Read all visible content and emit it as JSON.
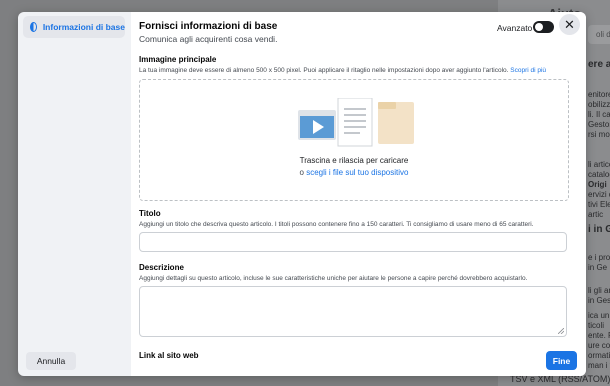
{
  "background": {
    "help_title": "Aiuto",
    "search_placeholder": "oli dell",
    "lines": [
      "enitore",
      "obilizz",
      "li. Il cat",
      "Gestor",
      "rsi mo",
      "li articol",
      "catalogo",
      "Origi",
      "ervizi d",
      "tivi Ele",
      "artic",
      "e i prodo",
      "in Ge",
      "li gli art",
      "in Gest",
      "ica un",
      "ticoli",
      "ente. P",
      "ure con",
      "ormati",
      "man i f",
      "i e gli i"
    ],
    "heads": [
      "ere ai",
      "i in G"
    ],
    "bottom": "TSV e XML (RSS/ATOM)"
  },
  "sidebar": {
    "items": [
      {
        "label": "Informazioni di base",
        "icon": "half-circle-icon"
      }
    ]
  },
  "header": {
    "title": "Fornisci informazioni di base",
    "subtitle": "Comunica agli acquirenti cosa vendi.",
    "advanced_label": "Avanzato",
    "advanced_enabled": false
  },
  "image_section": {
    "label": "Immagine principale",
    "description": "La tua immagine deve essere di almeno 500 x 500 pixel. Puoi applicare il ritaglio nelle impostazioni dopo aver aggiunto l'articolo.",
    "learn_more": "Scopri di più",
    "drop_text": "Trascina e rilascia per caricare",
    "or_text": "o",
    "choose_link": "scegli i file sul tuo dispositivo"
  },
  "title_section": {
    "label": "Titolo",
    "description": "Aggiungi un titolo che descriva questo articolo. I titoli possono contenere fino a 150 caratteri. Ti consigliamo di usare meno di 65 caratteri.",
    "value": ""
  },
  "description_section": {
    "label": "Descrizione",
    "description": "Aggiungi dettagli su questo articolo, incluse le sue caratteristiche uniche per aiutare le persone a capire perché dovrebbero acquistarlo.",
    "value": ""
  },
  "website_section": {
    "label": "Link al sito web"
  },
  "footer": {
    "cancel_label": "Annulla",
    "done_label": "Fine"
  },
  "colors": {
    "accent": "#1b74e4",
    "overlay": "#7e7f81"
  }
}
